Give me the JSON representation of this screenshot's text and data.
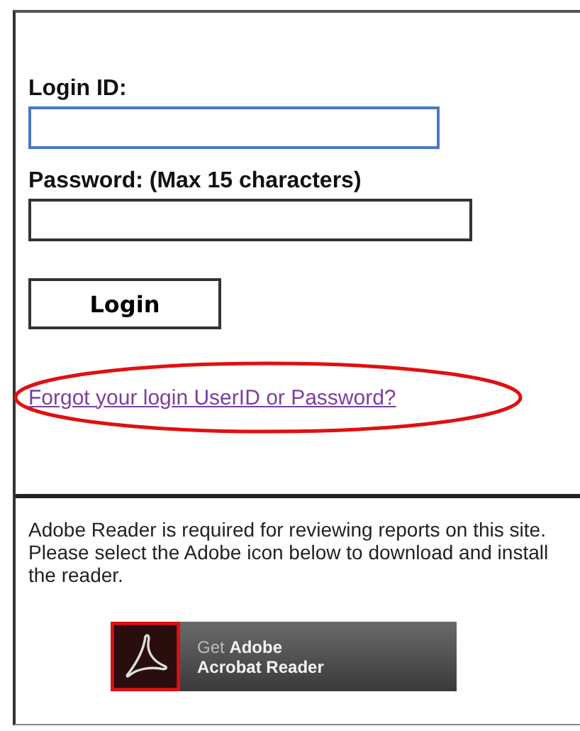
{
  "login_form": {
    "fields": [
      {
        "label": "Login ID:",
        "focused": true
      },
      {
        "label": "Password: (Max 15 characters)",
        "focused": false
      }
    ],
    "button": "Login",
    "forgot_link": {
      "text": "Forgot your login UserID or Password?",
      "highlighted": true
    }
  },
  "adobe_notice": {
    "text": "Adobe Reader is required for reviewing reports on this site. Please select the Adobe icon below to download and install the reader.",
    "badge": {
      "line_1": "Get **Adobe**",
      "line_2": "Acrobat Reader"
    }
  }
}
